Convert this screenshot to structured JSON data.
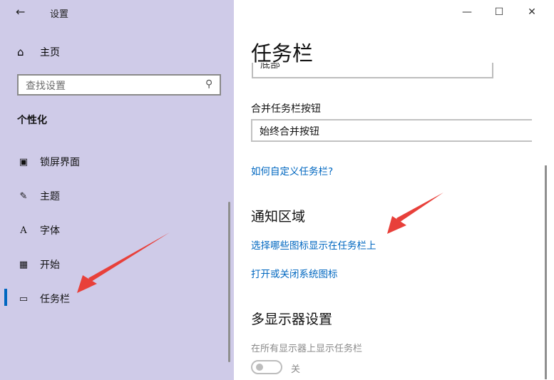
{
  "window": {
    "title": "设置"
  },
  "sidebar": {
    "home_label": "主页",
    "search_placeholder": "查找设置",
    "section_title": "个性化",
    "items": [
      {
        "label": "锁屏界面",
        "icon": "lock-screen-icon"
      },
      {
        "label": "主题",
        "icon": "theme-icon"
      },
      {
        "label": "字体",
        "icon": "font-icon"
      },
      {
        "label": "开始",
        "icon": "start-icon"
      },
      {
        "label": "任务栏",
        "icon": "taskbar-icon",
        "active": true
      }
    ]
  },
  "main": {
    "page_title": "任务栏",
    "position_value": "底部",
    "combine_label": "合并任务栏按钮",
    "combine_value": "始终合并按钮",
    "customize_link": "如何自定义任务栏?",
    "notification_heading": "通知区域",
    "select_icons_link": "选择哪些图标显示在任务栏上",
    "system_icons_link": "打开或关闭系统图标",
    "multi_display_heading": "多显示器设置",
    "show_on_all_label": "在所有显示器上显示任务栏",
    "show_on_all_state": "关"
  },
  "colors": {
    "sidebar_bg": "#cfcbe8",
    "accent": "#0067c0",
    "annotation_arrow": "#e8403a"
  }
}
